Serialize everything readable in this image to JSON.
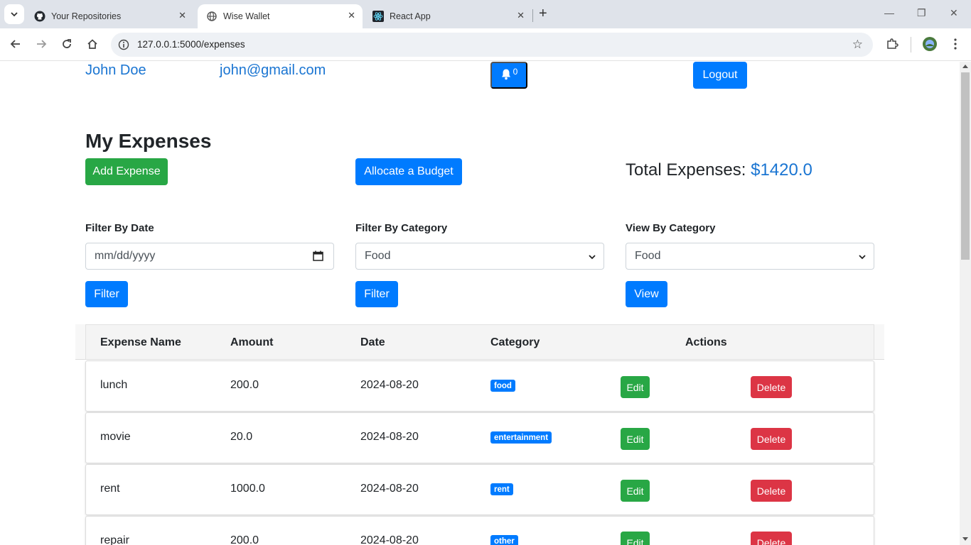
{
  "browser": {
    "tabs": [
      {
        "title": "Your Repositories",
        "icon": "github-icon"
      },
      {
        "title": "Wise Wallet",
        "icon": "globe-icon"
      },
      {
        "title": "React App",
        "icon": "react-icon"
      }
    ],
    "url": "127.0.0.1:5000/expenses"
  },
  "header": {
    "user_name": "John Doe",
    "user_email": "john@gmail.com",
    "notification_count": "0",
    "logout_label": "Logout"
  },
  "main": {
    "title": "My Expenses",
    "add_expense_label": "Add Expense",
    "allocate_budget_label": "Allocate a Budget",
    "total_label": "Total Expenses:",
    "total_value": "$1420.0"
  },
  "filters": {
    "date": {
      "label": "Filter By Date",
      "placeholder": "mm/dd/yyyy",
      "button": "Filter"
    },
    "category": {
      "label": "Filter By Category",
      "selected": "Food",
      "button": "Filter"
    },
    "view": {
      "label": "View By Category",
      "selected": "Food",
      "button": "View"
    }
  },
  "table": {
    "headers": [
      "Expense Name",
      "Amount",
      "Date",
      "Category",
      "Actions"
    ],
    "edit_label": "Edit",
    "delete_label": "Delete",
    "rows": [
      {
        "name": "lunch",
        "amount": "200.0",
        "date": "2024-08-20",
        "category": "food"
      },
      {
        "name": "movie",
        "amount": "20.0",
        "date": "2024-08-20",
        "category": "entertainment"
      },
      {
        "name": "rent",
        "amount": "1000.0",
        "date": "2024-08-20",
        "category": "rent"
      },
      {
        "name": "repair",
        "amount": "200.0",
        "date": "2024-08-20",
        "category": "other"
      }
    ]
  },
  "colors": {
    "primary": "#007bff",
    "success": "#28a745",
    "danger": "#dc3545",
    "link": "#1a75d2"
  }
}
